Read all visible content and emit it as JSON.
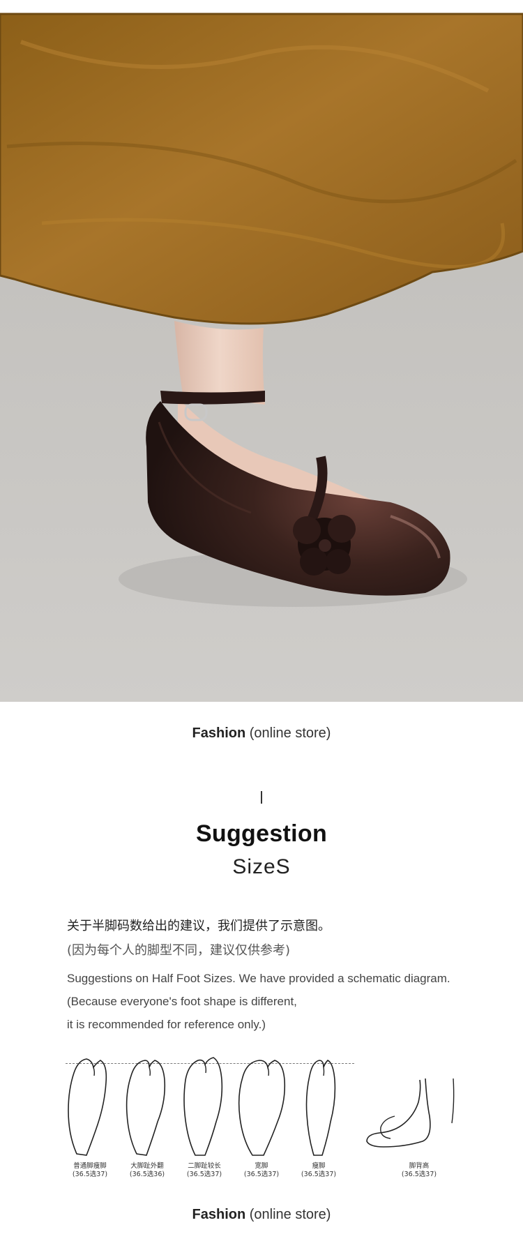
{
  "photo": {
    "alt_name": "product-photo"
  },
  "captions": {
    "top": {
      "brand": "Fashion",
      "suffix": "(online store)"
    },
    "bottom": {
      "brand": "Fashion",
      "suffix": "(online store)"
    }
  },
  "section": {
    "mark": "I",
    "title": "Suggestion",
    "subtitle": "SizeS"
  },
  "notes": {
    "cn_line1": "关于半脚码数给出的建议，我们提供了示意图。",
    "cn_line2": "(因为每个人的脚型不同，建议仅供参考)",
    "en_line1": "Suggestions on Half Foot Sizes. We have provided a schematic diagram.",
    "en_line2": "(Because everyone's foot shape is different,",
    "en_line3": "it is recommended for reference only.)"
  },
  "feet": [
    {
      "name": "普通脚瘦脚",
      "size": "(36.5选37)"
    },
    {
      "name": "大脚趾外翻",
      "size": "(36.5选36)"
    },
    {
      "name": "二脚趾较长",
      "size": "(36.5选37)"
    },
    {
      "name": "宽脚",
      "size": "(36.5选37)"
    },
    {
      "name": "瘦脚",
      "size": "(36.5选37)"
    },
    {
      "name": "脚背高",
      "size": "(36.5选37)"
    }
  ],
  "colors": {
    "skirt": "#9a6a1e",
    "floor": "#c4c2bf",
    "shoe": "#2e1a17"
  }
}
